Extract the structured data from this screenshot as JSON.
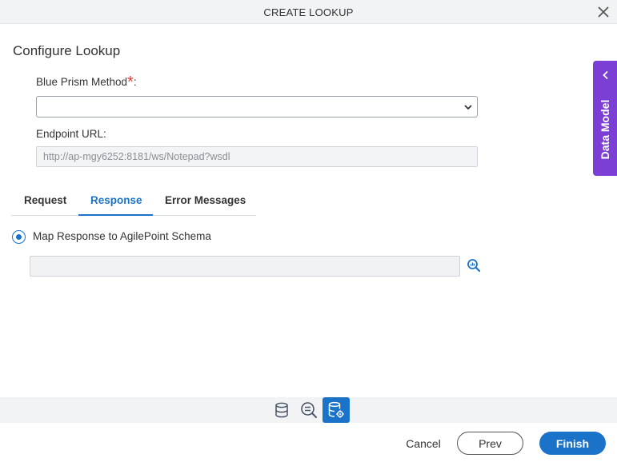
{
  "dialog": {
    "title": "CREATE LOOKUP",
    "close_icon": "close-icon"
  },
  "heading": "Configure Lookup",
  "form": {
    "method_label": "Blue Prism Method",
    "required_mark": "*",
    "method_colon": ":",
    "method_value": "",
    "endpoint_label": "Endpoint URL:",
    "endpoint_value": "http://ap-mgy6252:8181/ws/Notepad?wsdl"
  },
  "tabs": [
    {
      "label": "Request",
      "active": false
    },
    {
      "label": "Response",
      "active": true
    },
    {
      "label": "Error Messages",
      "active": false
    }
  ],
  "response": {
    "option_label": "Map Response to AgilePoint Schema",
    "selected": true,
    "schema_value": ""
  },
  "side_panel": {
    "label": "Data Model"
  },
  "footer": {
    "cancel": "Cancel",
    "prev": "Prev",
    "finish": "Finish"
  },
  "colors": {
    "accent": "#1a73c8",
    "side_tab": "#7c3fd6",
    "required": "#e53935"
  }
}
